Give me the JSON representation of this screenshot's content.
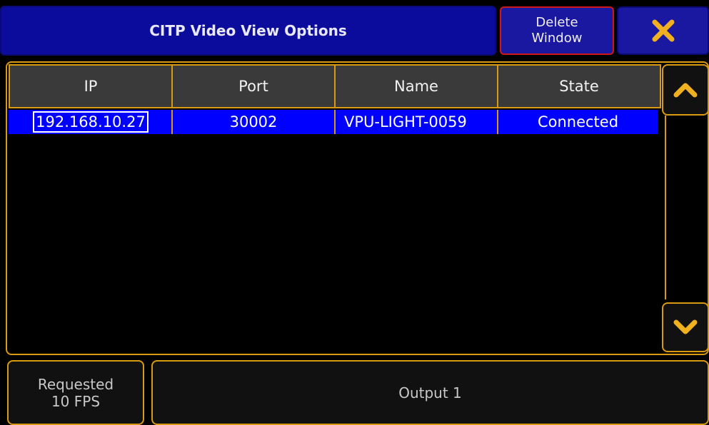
{
  "window": {
    "title": "CITP Video View Options",
    "delete_label": "Delete\nWindow"
  },
  "table": {
    "columns": [
      "IP",
      "Port",
      "Name",
      "State"
    ],
    "rows": [
      {
        "ip": "192.168.10.27",
        "port": "30002",
        "name": "VPU-LIGHT-0059",
        "state": "Connected"
      }
    ]
  },
  "footer": {
    "fps_label": "Requested\n10 FPS",
    "output_label": "Output 1"
  },
  "colors": {
    "accent": "#d89a10",
    "selection": "#0000ff",
    "title_bg": "#0c0c9c",
    "close_icon": "#f0b020"
  },
  "icons": {
    "close": "close-icon",
    "up": "chevron-up-icon",
    "down": "chevron-down-icon"
  }
}
